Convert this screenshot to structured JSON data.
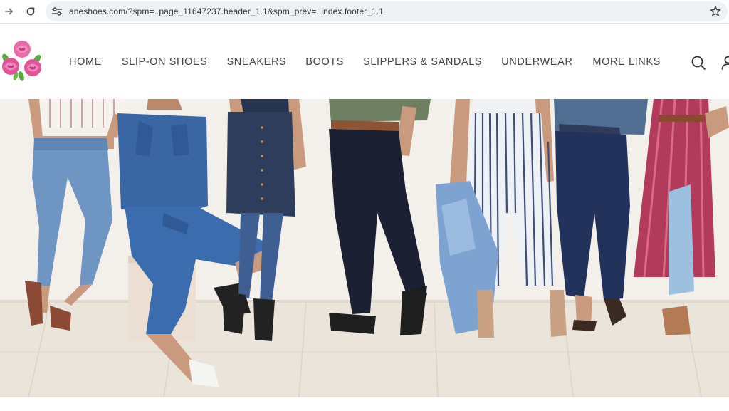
{
  "browser": {
    "url": "aneshoes.com/?spm=..page_11647237.header_1.1&spm_prev=..index.footer_1.1",
    "icons": [
      "arrow-forward-icon",
      "reload-icon",
      "site-settings-icon",
      "bookmark-star-icon"
    ]
  },
  "header": {
    "logo_icon": "rose-bouquet-logo",
    "nav": {
      "home": "HOME",
      "slip_on": "SLIP-ON SHOES",
      "sneakers": "SNEAKERS",
      "boots": "BOOTS",
      "slippers_sandals": "SLIPPERS & SANDALS",
      "underwear": "UNDERWEAR",
      "more_links": "MORE LINKS"
    },
    "icons": [
      "search-icon",
      "account-icon"
    ]
  },
  "hero": {
    "image": "banner-women-in-denim-and-sandals"
  },
  "colors": {
    "nav_text": "#444444",
    "url_bar": "#eef1f6",
    "logo_pink": "#e0559a",
    "wall": "#f2eee9",
    "floor": "#e9e2d8"
  }
}
